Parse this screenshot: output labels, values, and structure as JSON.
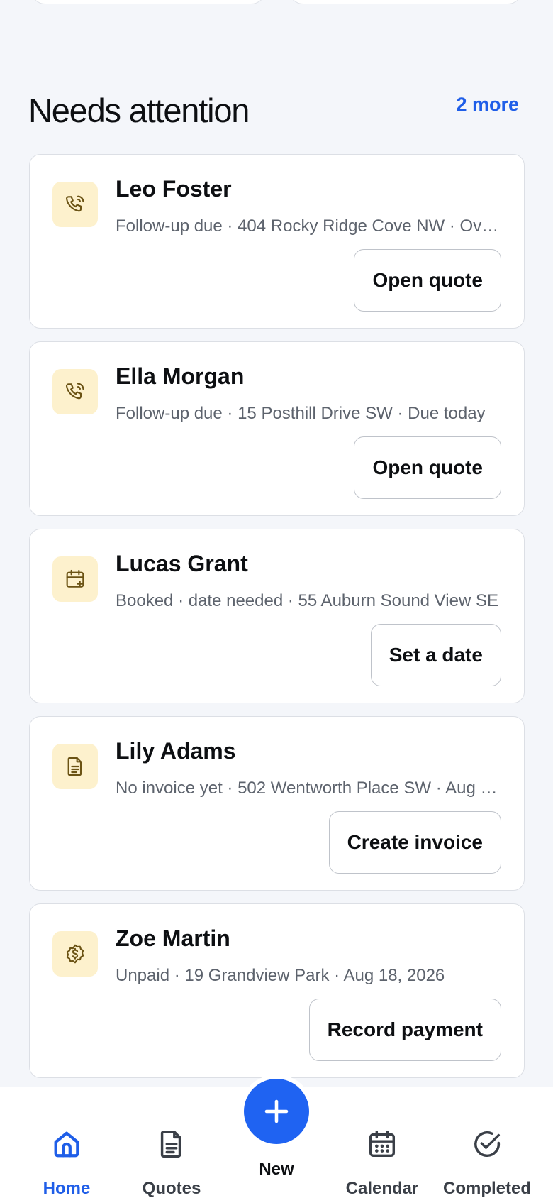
{
  "section": {
    "title": "Needs attention",
    "more_label": "2 more"
  },
  "cards": [
    {
      "name": "Leo Foster",
      "detail": "Follow-up due · 404 Rocky Ridge Cove NW · Ov…",
      "action": "Open quote",
      "icon": "phone-icon"
    },
    {
      "name": "Ella Morgan",
      "detail": "Follow-up due · 15 Posthill Drive SW · Due today",
      "action": "Open quote",
      "icon": "phone-icon"
    },
    {
      "name": "Lucas Grant",
      "detail": "Booked · date needed · 55 Auburn Sound View SE",
      "action": "Set a date",
      "icon": "calendar-plus-icon"
    },
    {
      "name": "Lily Adams",
      "detail": "No invoice yet · 502 Wentworth Place SW · Aug …",
      "action": "Create invoice",
      "icon": "document-icon"
    },
    {
      "name": "Zoe Martin",
      "detail": "Unpaid · 19 Grandview Park · Aug 18, 2026",
      "action": "Record payment",
      "icon": "dollar-badge-icon"
    }
  ],
  "nav": {
    "home": "Home",
    "quotes": "Quotes",
    "new": "New",
    "calendar": "Calendar",
    "completed": "Completed"
  },
  "colors": {
    "accent": "#1f5ee8",
    "icon_bg": "#fdf1cd",
    "icon_fg": "#6b5314",
    "background": "#f4f6fa"
  }
}
